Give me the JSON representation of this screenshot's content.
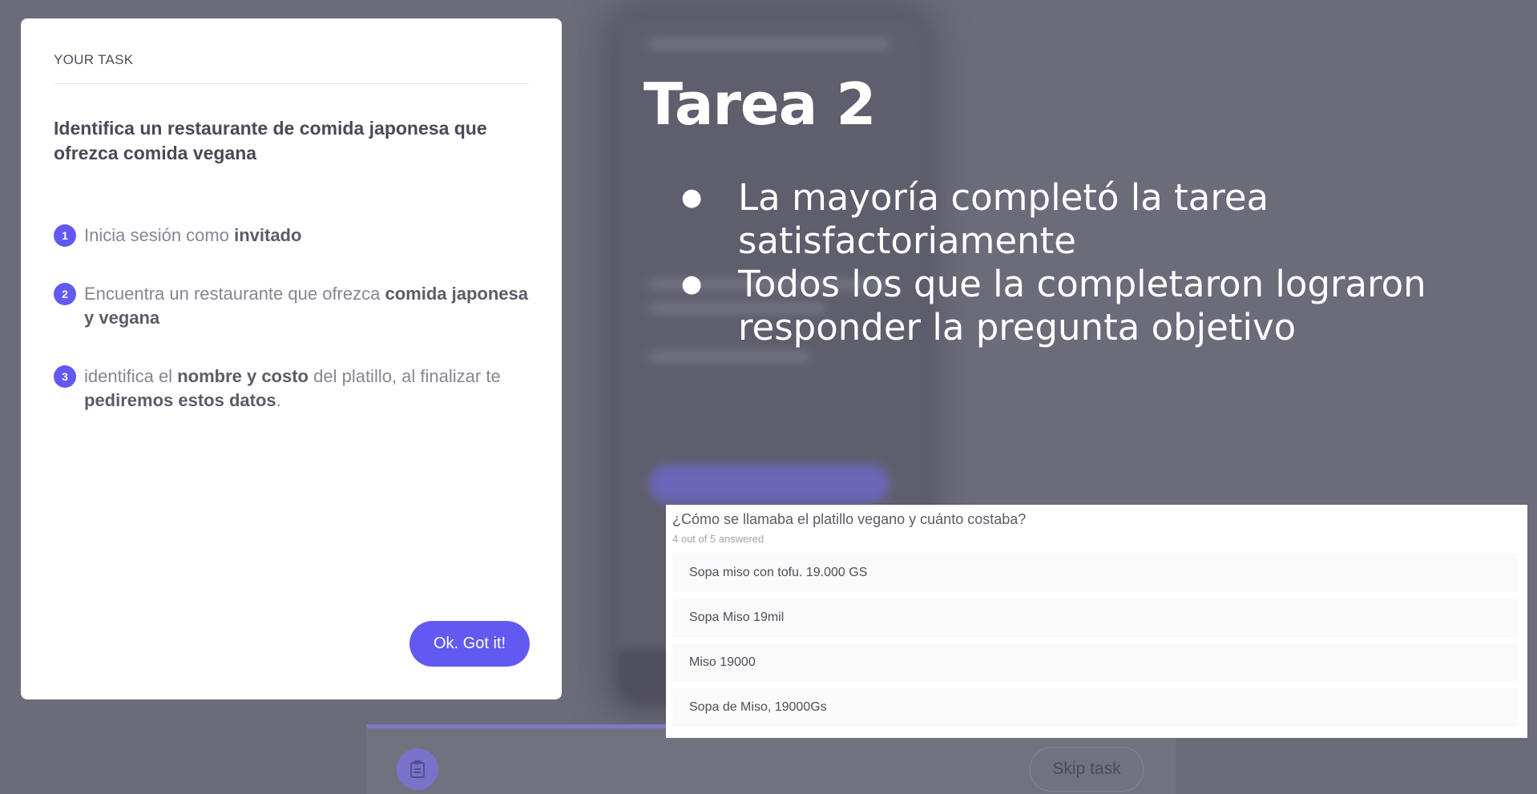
{
  "task_card": {
    "label": "YOUR TASK",
    "title": "Identifica un restaurante de comida japonesa que ofrezca comida vegana",
    "steps": [
      {
        "num": "1",
        "pre": "Inicia sesión como ",
        "bold": "invitado",
        "post": ""
      },
      {
        "num": "2",
        "pre": "Encuentra un restaurante que ofrezca ",
        "bold": "comida japonesa y vegana",
        "post": ""
      },
      {
        "num": "3",
        "pre": "identifica el ",
        "bold": "nombre y costo",
        "mid": " del platillo, al finalizar te ",
        "bold2": "pediremos estos datos",
        "post": "."
      }
    ],
    "ok_button": "Ok. Got it!"
  },
  "slide": {
    "title": "Tarea 2",
    "bullets": [
      "La mayoría completó la tarea satisfactoriamente",
      "Todos los que la completaron lograron responder la pregunta objetivo"
    ],
    "bullet_glyph": "●"
  },
  "survey": {
    "question": "¿Cómo se llamaba el platillo vegano y cuánto costaba?",
    "answered": "4 out of 5 answered",
    "answers": [
      "Sopa miso con tofu. 19.000 GS",
      "Sopa Miso 19mil",
      "Miso 19000",
      "Sopa de Miso, 19000Gs"
    ]
  },
  "toolbar": {
    "skip_label": "Skip task",
    "clipboard_icon": "clipboard-icon"
  },
  "colors": {
    "accent": "#6259f2",
    "overlay": "#6c6b7a"
  }
}
